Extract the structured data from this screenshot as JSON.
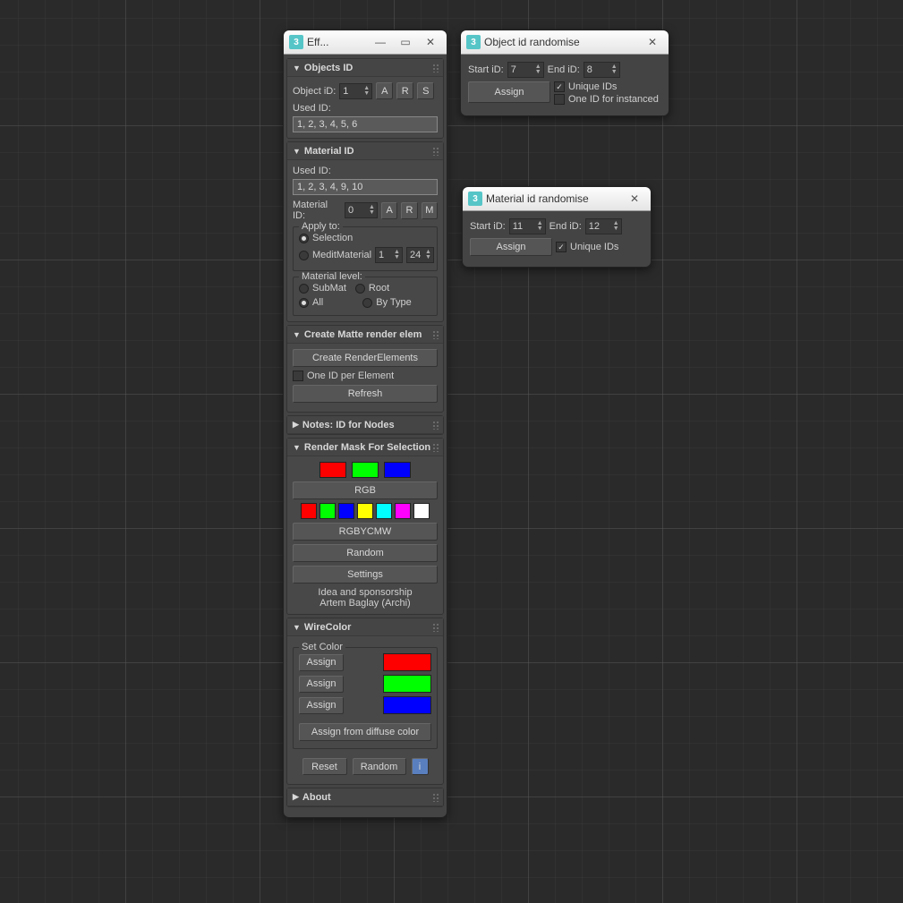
{
  "main": {
    "title": "Eff...",
    "icon": "3",
    "objectsId": {
      "header": "Objects ID",
      "objectIdLabel": "Object iD:",
      "objectIdValue": "1",
      "btnA": "A",
      "btnR": "R",
      "btnS": "S",
      "usedIdLabel": "Used ID:",
      "usedIdValue": "1, 2, 3, 4, 5, 6"
    },
    "materialId": {
      "header": "Material ID",
      "usedIdLabel": "Used ID:",
      "usedIdValue": "1, 2, 3, 4, 9, 10",
      "materialIdLabel": "Material ID:",
      "materialIdValue": "0",
      "btnA": "A",
      "btnR": "R",
      "btnM": "M",
      "applyTo": {
        "title": "Apply to:",
        "selection": "Selection",
        "meditMaterial": "MeditMaterial",
        "meditVal1": "1",
        "meditVal2": "24"
      },
      "matLevel": {
        "title": "Material level:",
        "subMat": "SubMat",
        "root": "Root",
        "all": "All",
        "byType": "By Type"
      }
    },
    "matte": {
      "header": "Create Matte render elem",
      "createBtn": "Create RenderElements",
      "oneIdPer": "One ID per Element",
      "refresh": "Refresh"
    },
    "notes": {
      "header": "Notes: ID for Nodes"
    },
    "renderMask": {
      "header": "Render Mask For Selection",
      "rgbBtn": "RGB",
      "rgbycmwBtn": "RGBYCMW",
      "randomBtn": "Random",
      "settingsBtn": "Settings",
      "credit1": "Idea and sponsorship",
      "credit2": "Artem Baglay (Archi)",
      "bigColors": [
        "#ff0000",
        "#00ff00",
        "#0000ff"
      ],
      "smallColors": [
        "#ff0000",
        "#00ff00",
        "#0000ff",
        "#ffff00",
        "#00ffff",
        "#ff00ff",
        "#ffffff"
      ]
    },
    "wireColor": {
      "header": "WireColor",
      "setColor": "Set Color",
      "assign": "Assign",
      "colors": [
        "#ff0000",
        "#00ff00",
        "#0000ff"
      ],
      "assignDiffuse": "Assign from diffuse color",
      "reset": "Reset",
      "random": "Random",
      "info": "i"
    },
    "about": {
      "header": "About"
    }
  },
  "objRand": {
    "title": "Object id randomise",
    "icon": "3",
    "startLabel": "Start iD:",
    "startVal": "7",
    "endLabel": "End iD:",
    "endVal": "8",
    "assign": "Assign",
    "unique": "Unique IDs",
    "oneId": "One ID for instanced"
  },
  "matRand": {
    "title": "Material id randomise",
    "icon": "3",
    "startLabel": "Start iD:",
    "startVal": "11",
    "endLabel": "End iD:",
    "endVal": "12",
    "assign": "Assign",
    "unique": "Unique IDs"
  }
}
